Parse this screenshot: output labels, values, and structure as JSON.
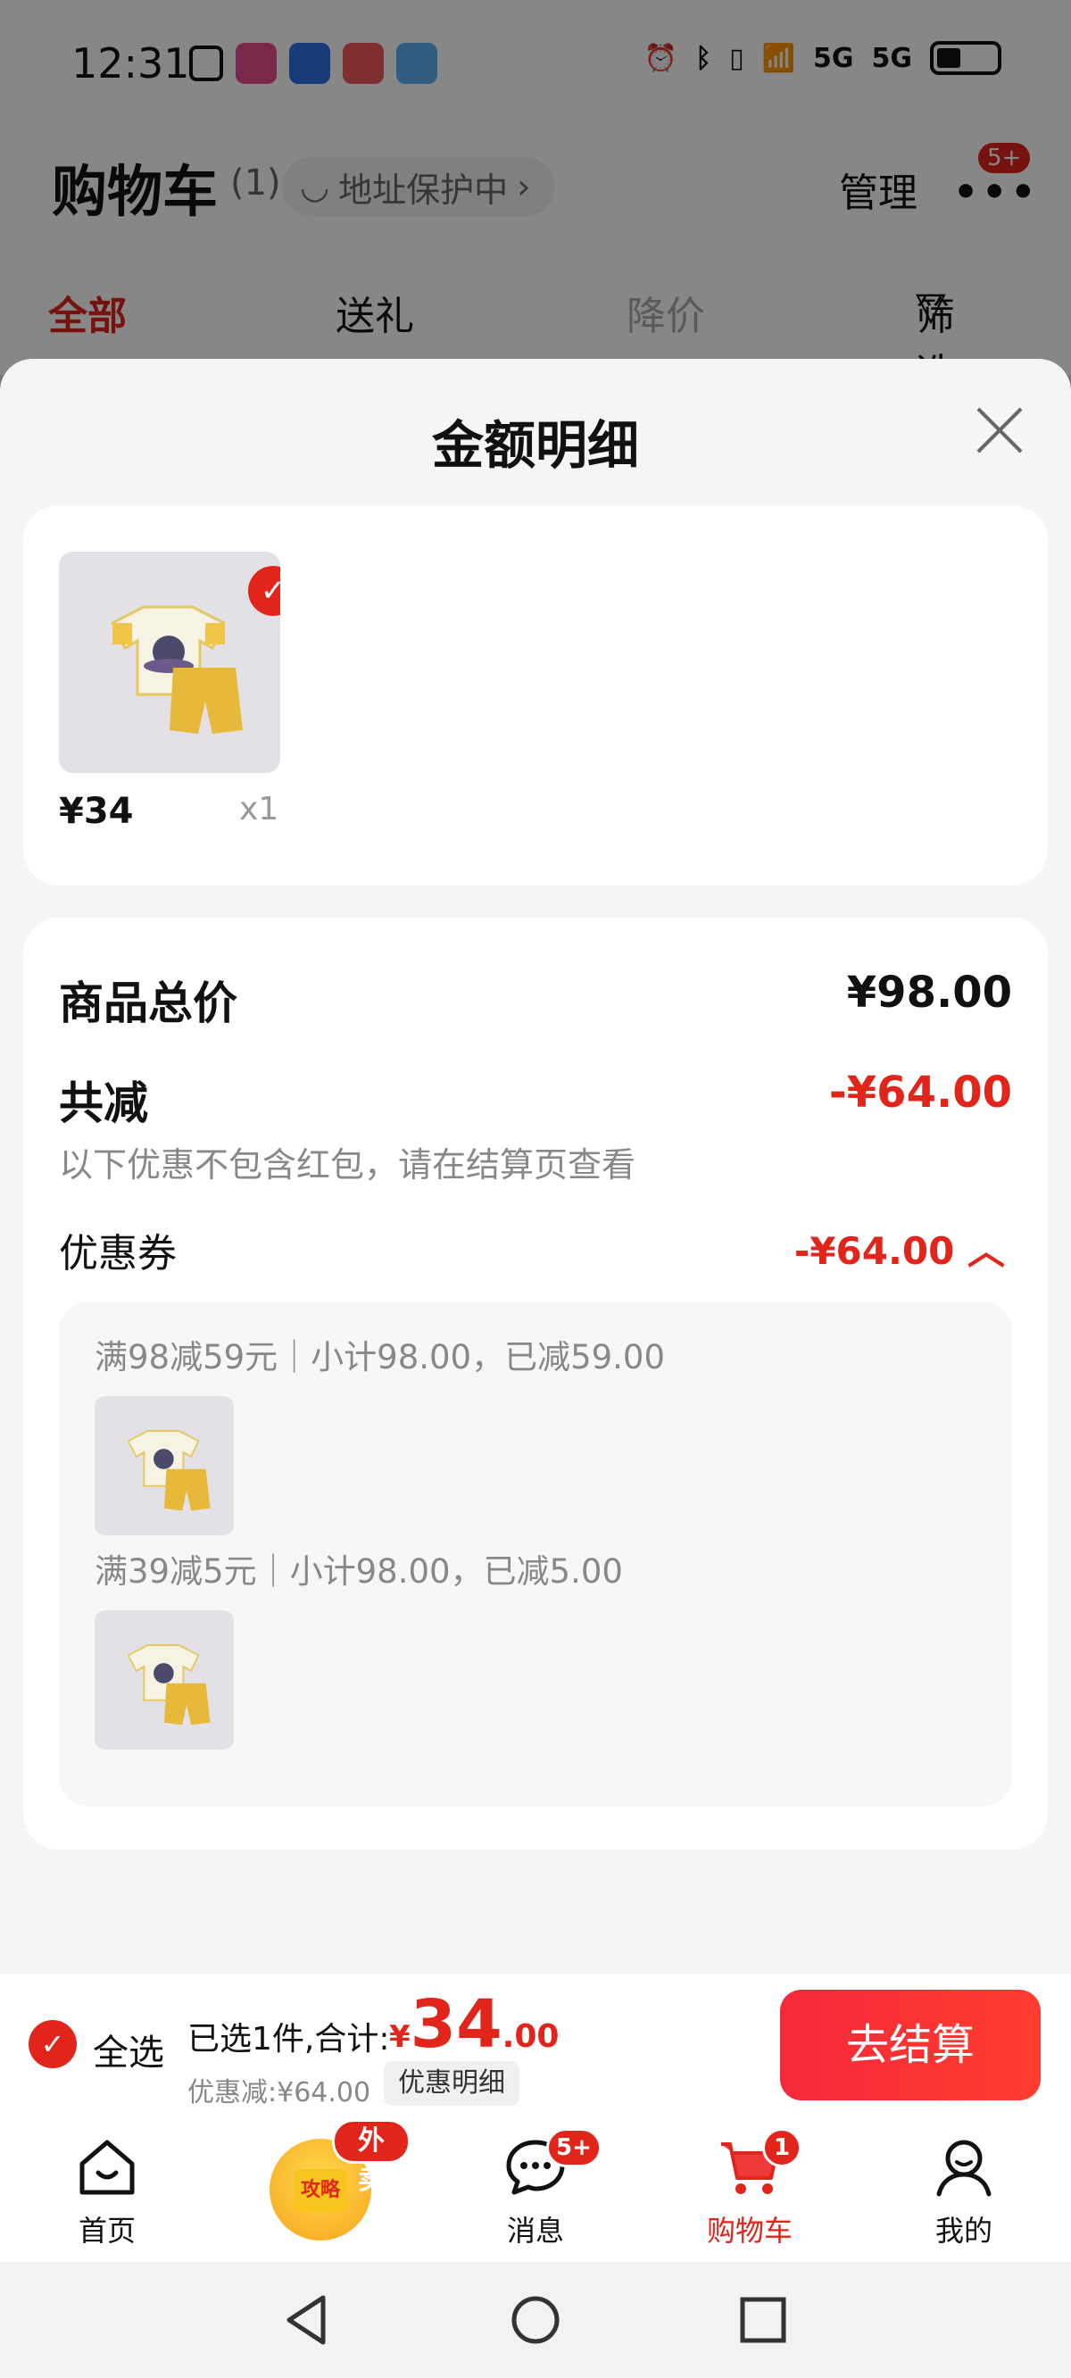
{
  "status_bar": {
    "time": "12:31",
    "network_label_1": "5G",
    "network_label_2": "5G"
  },
  "cart_header": {
    "title": "购物车",
    "count": "(1)",
    "address_protect": "地址保护中",
    "manage": "管理",
    "more_badge": "5+"
  },
  "filter_tabs": {
    "all": "全部",
    "gift": "送礼",
    "price_drop": "降价",
    "filter": "筛选"
  },
  "sheet": {
    "title": "金额明细",
    "product": {
      "price": "¥34",
      "qty": "x1",
      "check": "✓"
    },
    "summary": {
      "total_label": "商品总价",
      "total_value": "¥98.00",
      "reduce_label": "共减",
      "reduce_value": "-¥64.00",
      "reduce_note": "以下优惠不包含红包，请在结算页查看",
      "coupon_label": "优惠券",
      "coupon_value": "-¥64.00"
    },
    "coupons": [
      {
        "text": "满98减59元｜小计98.00，已减59.00"
      },
      {
        "text": "满39减5元｜小计98.00，已减5.00"
      }
    ]
  },
  "checkout": {
    "select_all": "全选",
    "selected_info": "已选1件,合计:",
    "total_yen": "¥",
    "total_int": "34",
    "total_dec": ".00",
    "discount_info": "优惠减:¥64.00",
    "detail_button": "优惠明细",
    "checkout_button": "去结算"
  },
  "tab_bar": {
    "home": "首页",
    "promo_badge": "外卖",
    "promo_inner": "攻略",
    "messages": "消息",
    "messages_badge": "5+",
    "cart": "购物车",
    "cart_badge": "1",
    "me": "我的"
  },
  "colors": {
    "accent_red": "#e1251b",
    "sheet_bg": "#f5f5f5"
  }
}
